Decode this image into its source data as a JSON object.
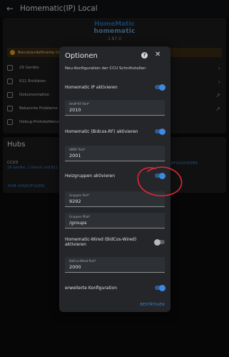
{
  "topbar": {
    "title": "Homematic(IP) Local"
  },
  "logo": {
    "line1": "HomeMatic",
    "line2": "homematic",
    "version": "1.67.0"
  },
  "main": {
    "warning": "Benutzerdefinierte Int",
    "rows": [
      {
        "label": "29 Geräte",
        "icon": "devices-icon"
      },
      {
        "label": "611 Entitäten",
        "icon": "entities-icon"
      },
      {
        "label": "Dokumentation",
        "icon": "document-icon"
      },
      {
        "label": "Bekannte Probleme",
        "icon": "bug-icon"
      },
      {
        "label": "Debug-Protokollierun",
        "icon": "debug-icon"
      }
    ]
  },
  "hubs": {
    "title": "Hubs",
    "hub_name": "CCU3",
    "hub_links": "29 Geräte, 1 Dienst und 611 Ent",
    "configure": "KONFIGURIEREN",
    "add": "HUB HINZUFÜGEN"
  },
  "dialog": {
    "title": "Optionen",
    "subtitle": "Neu-Konfiguration der CCU Schnittstellen",
    "toggles": {
      "hmip": {
        "label": "Homematic IP aktivieren",
        "on": true
      },
      "bidcos_rf": {
        "label": "Homematic (Bidcos-RF) aktivieren",
        "on": true
      },
      "groups": {
        "label": "Heizgruppen aktivieren",
        "on": true
      },
      "bidcos_wired": {
        "label": "Homematic-Wired (BidCos-Wired) aktivieren",
        "on": false
      },
      "advanced": {
        "label": "erweiterte Konfiguration",
        "on": true
      }
    },
    "fields": {
      "hmip_port": {
        "label": "HmIP-RF Port*",
        "value": "2010"
      },
      "rf_port": {
        "label": "HMRF Port*",
        "value": "2001"
      },
      "groups_port": {
        "label": "Gruppen Port*",
        "value": "9292"
      },
      "groups_path": {
        "label": "Gruppen Pfad*",
        "value": "/groups"
      },
      "wired_port": {
        "label": "BidCos-Wired Port*",
        "value": "2000"
      }
    },
    "confirm": "BESTÄTIGEN"
  },
  "colors": {
    "accent": "#3d8ae0",
    "annotation": "#e0283a",
    "dialog_bg": "#24262a"
  }
}
